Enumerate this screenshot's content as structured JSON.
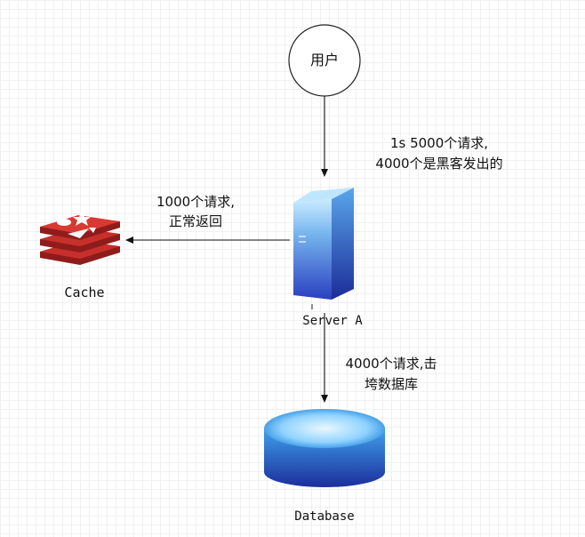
{
  "nodes": {
    "user": {
      "label": "用户"
    },
    "server": {
      "label": "Server A"
    },
    "cache": {
      "label": "Cache"
    },
    "database": {
      "label": "Database"
    }
  },
  "edges": {
    "user_to_server": {
      "label_line1": "1s 5000个请求,",
      "label_line2": "4000个是黑客发出的"
    },
    "server_to_cache": {
      "label_line1": "1000个请求,",
      "label_line2": "正常返回"
    },
    "server_to_database": {
      "label_line1": "4000个请求,击",
      "label_line2": "垮数据库"
    }
  },
  "colors": {
    "redis_red": "#c6302b",
    "server_blue": "#2d57d8",
    "db_blue": "#1d3fae"
  }
}
